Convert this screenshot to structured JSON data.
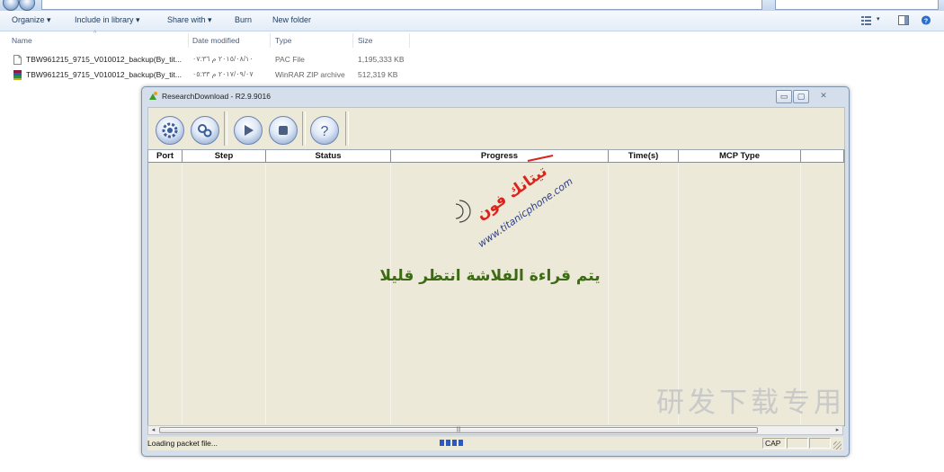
{
  "explorer": {
    "toolbar": {
      "organize": "Organize ▾",
      "include_in_library": "Include in library ▾",
      "share_with": "Share with ▾",
      "burn": "Burn",
      "new_folder": "New folder"
    },
    "columns": {
      "name": "Name",
      "date_modified": "Date modified",
      "type": "Type",
      "size": "Size"
    },
    "files": [
      {
        "name": "TBW961215_9715_V010012_backup(By_tit...",
        "date": "٢٠١٥/٠٨/١٠ م ٠٧:٣٦",
        "type": "PAC File",
        "size": "1,195,333 KB",
        "icon": "document-icon"
      },
      {
        "name": "TBW961215_9715_V010012_backup(By_tit...",
        "date": "٢٠١٧/٠٩/٠٧ م ٠٥:٣٣",
        "type": "WinRAR ZIP archive",
        "size": "512,319 KB",
        "icon": "winrar-archive-icon"
      }
    ]
  },
  "research_download": {
    "title": "ResearchDownload - R2.9.9016",
    "toolbar_buttons": [
      "settings-gear-icon",
      "settings-multi-gear-icon",
      "play-icon",
      "stop-icon",
      "help-icon"
    ],
    "help_label": "?",
    "columns": [
      "Port",
      "Step",
      "Status",
      "Progress",
      "Time(s)",
      "MCP Type"
    ],
    "watermark_domain": "www.titanicphone.com",
    "watermark_brand": "تيتانك فون",
    "message": "يتم قراءة الفلاشة انتظر قليلا",
    "cjk_watermark": "研发下载专用",
    "status_text": "Loading packet file...",
    "status_progress_blocks": 4,
    "status_cap": "CAP"
  },
  "colors": {
    "accent": "#2b59c3",
    "message": "#3d6b14",
    "watermark_red": "#d9231c"
  }
}
